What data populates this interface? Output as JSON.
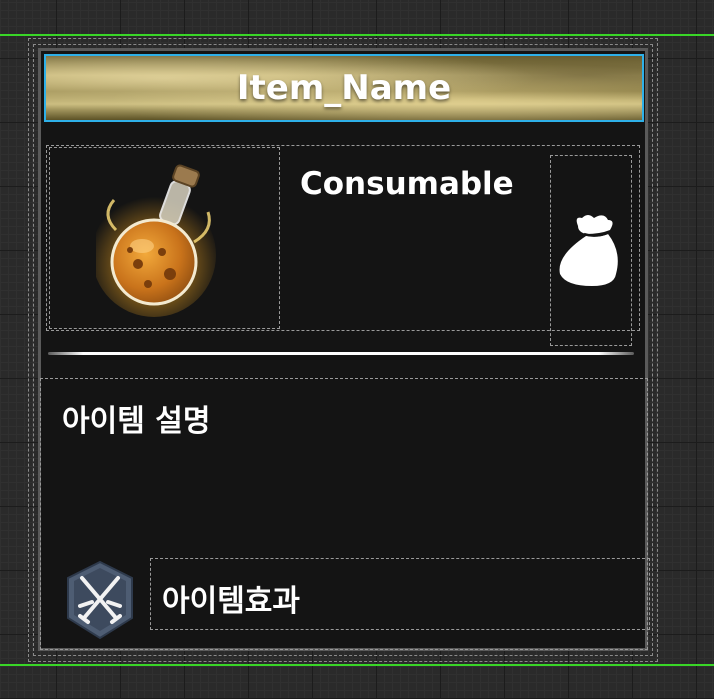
{
  "tooltip": {
    "item_name": "Item_Name",
    "item_type": "Consumable",
    "description_title": "아이템 설명",
    "effect_label": "아이템효과",
    "icons": {
      "item": "potion-flask-icon",
      "category": "money-bag-icon",
      "effect": "crossed-swords-icon"
    }
  }
}
